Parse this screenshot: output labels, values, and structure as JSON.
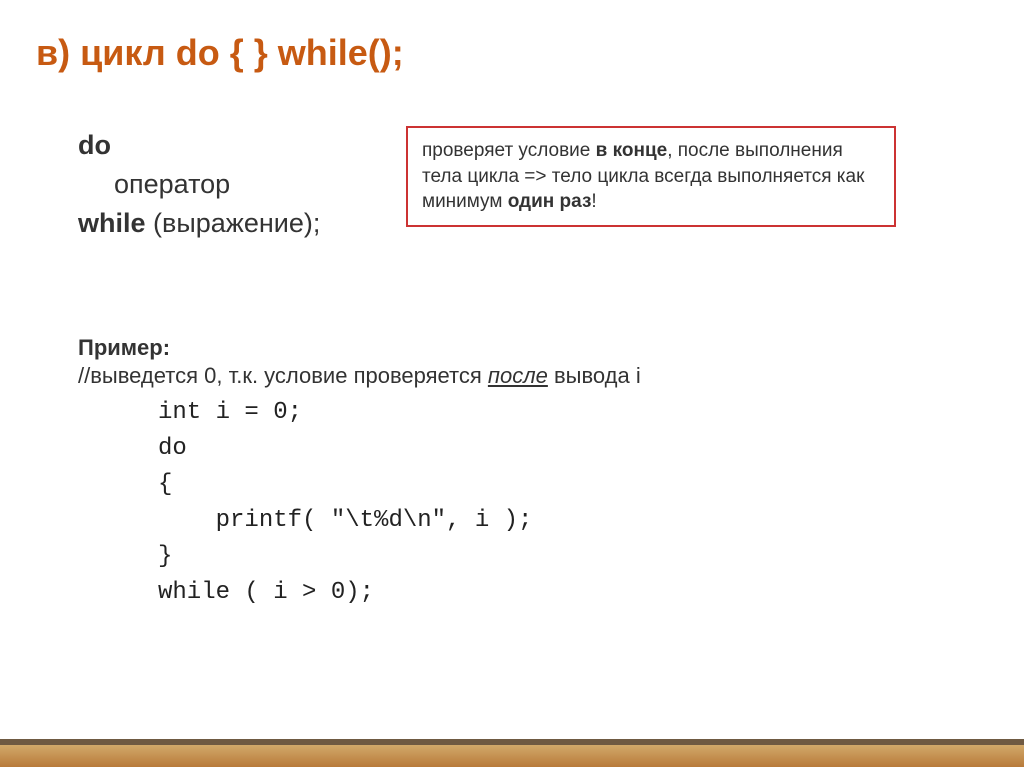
{
  "title": "в) цикл do {  } while();",
  "syntax": {
    "do": "do",
    "operator": "оператор",
    "while": "while",
    "expr": " (выражение);"
  },
  "note": {
    "p1": "проверяет условие ",
    "b1": "в конце",
    "p2": ", после выполнения тела цикла => тело цикла всегда выполняется как минимум ",
    "b2": "один раз",
    "p3": "!"
  },
  "example": {
    "label": "Пример:",
    "desc_pre": "//выведется 0, т.к. условие проверяется ",
    "desc_u": "после",
    "desc_post": " вывода i",
    "lines": {
      "l1": "int i = 0;",
      "l2": "do",
      "l3": "{",
      "l4": "    printf( \"\\t%d\\n\", i );",
      "l5": "}",
      "l6": "while ( i > 0);"
    }
  }
}
